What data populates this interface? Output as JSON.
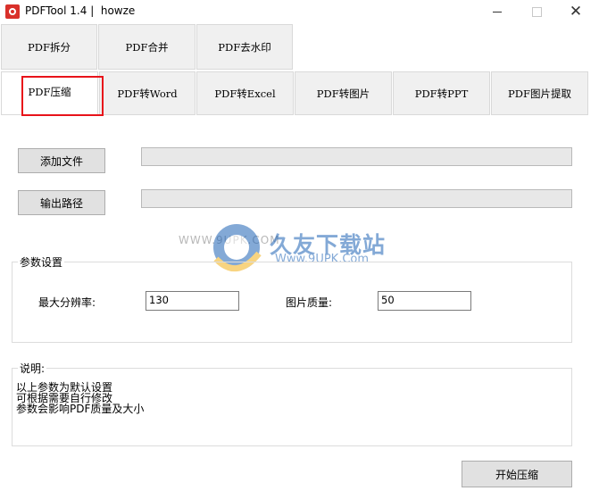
{
  "window": {
    "title": "PDFTool 1.4 |  howze",
    "min_glyph": "",
    "close_glyph": "✕"
  },
  "tabs": {
    "row1": [
      "PDF拆分",
      "PDF合并",
      "PDF去水印"
    ],
    "row2": [
      "PDF压缩",
      "PDF转Word",
      "PDF转Excel",
      "PDF转图片",
      "PDF转PPT",
      "PDF图片提取"
    ],
    "active": "PDF压缩"
  },
  "files": {
    "add_file_label": "添加文件",
    "output_path_label": "输出路径",
    "add_file_value": "",
    "output_path_value": ""
  },
  "params": {
    "group_label": "参数设置",
    "max_resolution_label": "最大分辨率:",
    "max_resolution_value": "130",
    "image_quality_label": "图片质量:",
    "image_quality_value": "50"
  },
  "description": {
    "label": "说明:",
    "lines": [
      "以上参数为默认设置",
      "可根据需要自行修改",
      "参数会影响PDF质量及大小"
    ]
  },
  "actions": {
    "start_compress_label": "开始压缩"
  },
  "watermark": {
    "site_name": "久友下载站",
    "url": "Www.9UPK.Com",
    "left_text": "WWW.9UPK.COM"
  },
  "colors": {
    "highlight": "#e8131a",
    "watermark_blue": "#1e63b6"
  }
}
